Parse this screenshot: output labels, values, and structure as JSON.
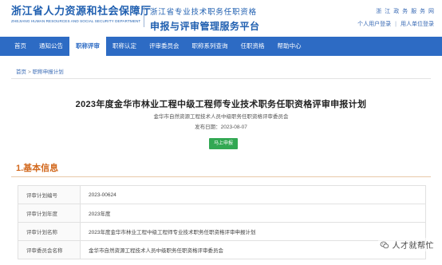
{
  "header": {
    "logo_cn": "浙江省人力资源和社会保障厅",
    "logo_en": "ZHEJIANG HUMAN RESOURCES AND SOCIAL SECURITY DEPARTMENT",
    "platform_top": "浙江省专业技术职务任职资格",
    "platform_main": "申报与评审管理服务平台",
    "gov_links": [
      "浙",
      "江",
      "政",
      "务",
      "服",
      "务",
      "网"
    ],
    "personal_login": "个人用户登录",
    "employer_login": "用人单位登录",
    "separator": "|"
  },
  "nav": {
    "items": [
      {
        "label": "首页",
        "active": false
      },
      {
        "label": "通知公告",
        "active": false
      },
      {
        "label": "职称评审",
        "active": true
      },
      {
        "label": "职称认定",
        "active": false
      },
      {
        "label": "评审委员会",
        "active": false
      },
      {
        "label": "职称系列查询",
        "active": false
      },
      {
        "label": "任职资格",
        "active": false
      },
      {
        "label": "帮助中心",
        "active": false
      }
    ]
  },
  "breadcrumb": {
    "home": "首页",
    "separator": ">",
    "current": "职称申报计划"
  },
  "plan": {
    "title": "2023年度金华市林业工程中级工程师专业技术职务任职资格评审申报计划",
    "committee": "金华市自然资源工程技术人员中级职务任职资格评审委员会",
    "date_label": "发布日期：",
    "date_value": "2023-08-07",
    "apply_button": "马上申报"
  },
  "section": {
    "title": "1.基本信息"
  },
  "info_rows": [
    {
      "label": "评审计划编号",
      "value": "2023-00624"
    },
    {
      "label": "评审计划年度",
      "value": "2023年度"
    },
    {
      "label": "评审计划名称",
      "value": "2023年度金华市林业工程中级工程师专业技术职务任职资格评审申报计划"
    },
    {
      "label": "评审委员会名称",
      "value": "金华市自然资源工程技术人员中级职务任职资格评审委员会"
    }
  ],
  "watermark": {
    "text": "人才就帮忙",
    "icon": "wechat-icon"
  },
  "colors": {
    "brand_blue": "#1f5fb0",
    "nav_blue": "#2d6bc4",
    "section_orange": "#d2691e",
    "button_green": "#32a853"
  }
}
